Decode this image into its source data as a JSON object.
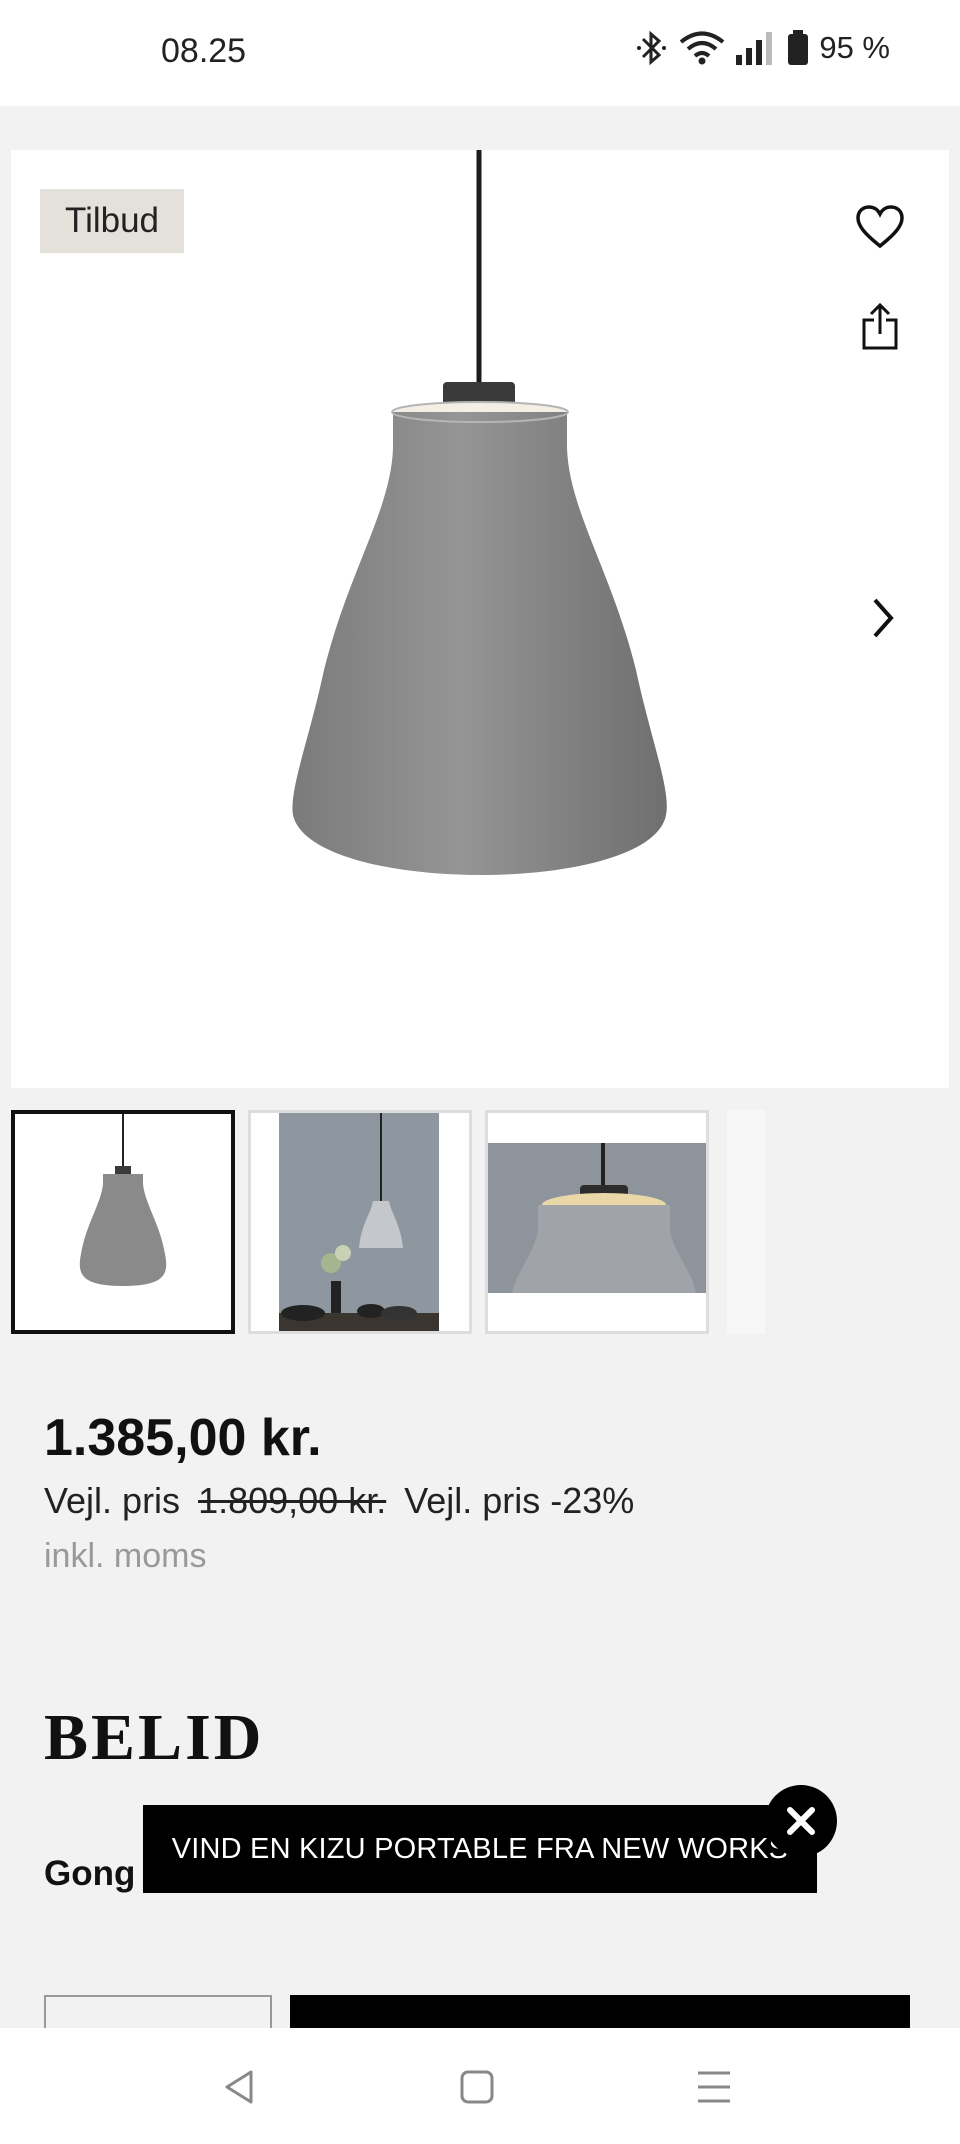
{
  "status_bar": {
    "time": "08.25",
    "battery": "95 %"
  },
  "product": {
    "badge": "Tilbud",
    "price": "1.385,00 kr.",
    "rrp_label": "Vejl. pris",
    "rrp_value": "1.809,00 kr.",
    "discount_label": "Vejl. pris -23%",
    "vat_note": "inkl. moms",
    "brand": "BELID",
    "name": "Gong"
  },
  "promo": {
    "text": "VIND EN KIZU PORTABLE FRA NEW WORKS"
  },
  "colors": {
    "accent": "#000000",
    "badge_bg": "#e3e1d9",
    "page_bg": "#f2f2f2",
    "lamp": "#8a8a8a"
  },
  "icons": [
    "bluetooth-icon",
    "wifi-icon",
    "signal-icon",
    "battery-icon",
    "heart-icon",
    "share-icon",
    "chevron-right-icon",
    "close-icon",
    "nav-back-icon",
    "nav-home-icon",
    "nav-menu-icon"
  ]
}
